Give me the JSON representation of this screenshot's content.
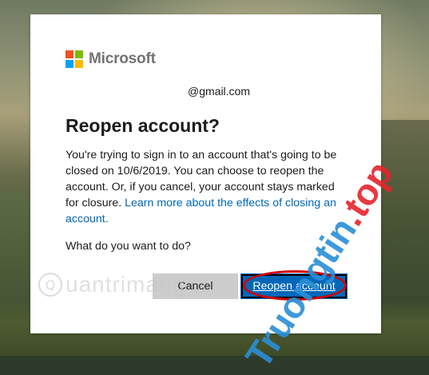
{
  "brand": {
    "name": "Microsoft",
    "colors": {
      "red": "#f25022",
      "green": "#7fba00",
      "blue": "#00a4ef",
      "yellow": "#ffb900"
    }
  },
  "account": {
    "email": "@gmail.com"
  },
  "dialog": {
    "title": "Reopen account?",
    "body_text": "You're trying to sign in to an account that's going to be closed on 10/6/2019. You can choose to reopen the account. Or, if you cancel, your account stays marked for closure.",
    "learn_more_link": "Learn more about the effects of closing an account.",
    "question": "What do you want to do?",
    "cancel_label": "Cancel",
    "reopen_label": "Reopen account"
  },
  "watermarks": {
    "left_text": "uantrimang",
    "left_icon": "Q",
    "right_text_main": "Truongtin",
    "right_text_accent": ".top"
  },
  "colors": {
    "accent": "#0067b8",
    "link": "#0067b8",
    "annotation": "#d40000"
  }
}
